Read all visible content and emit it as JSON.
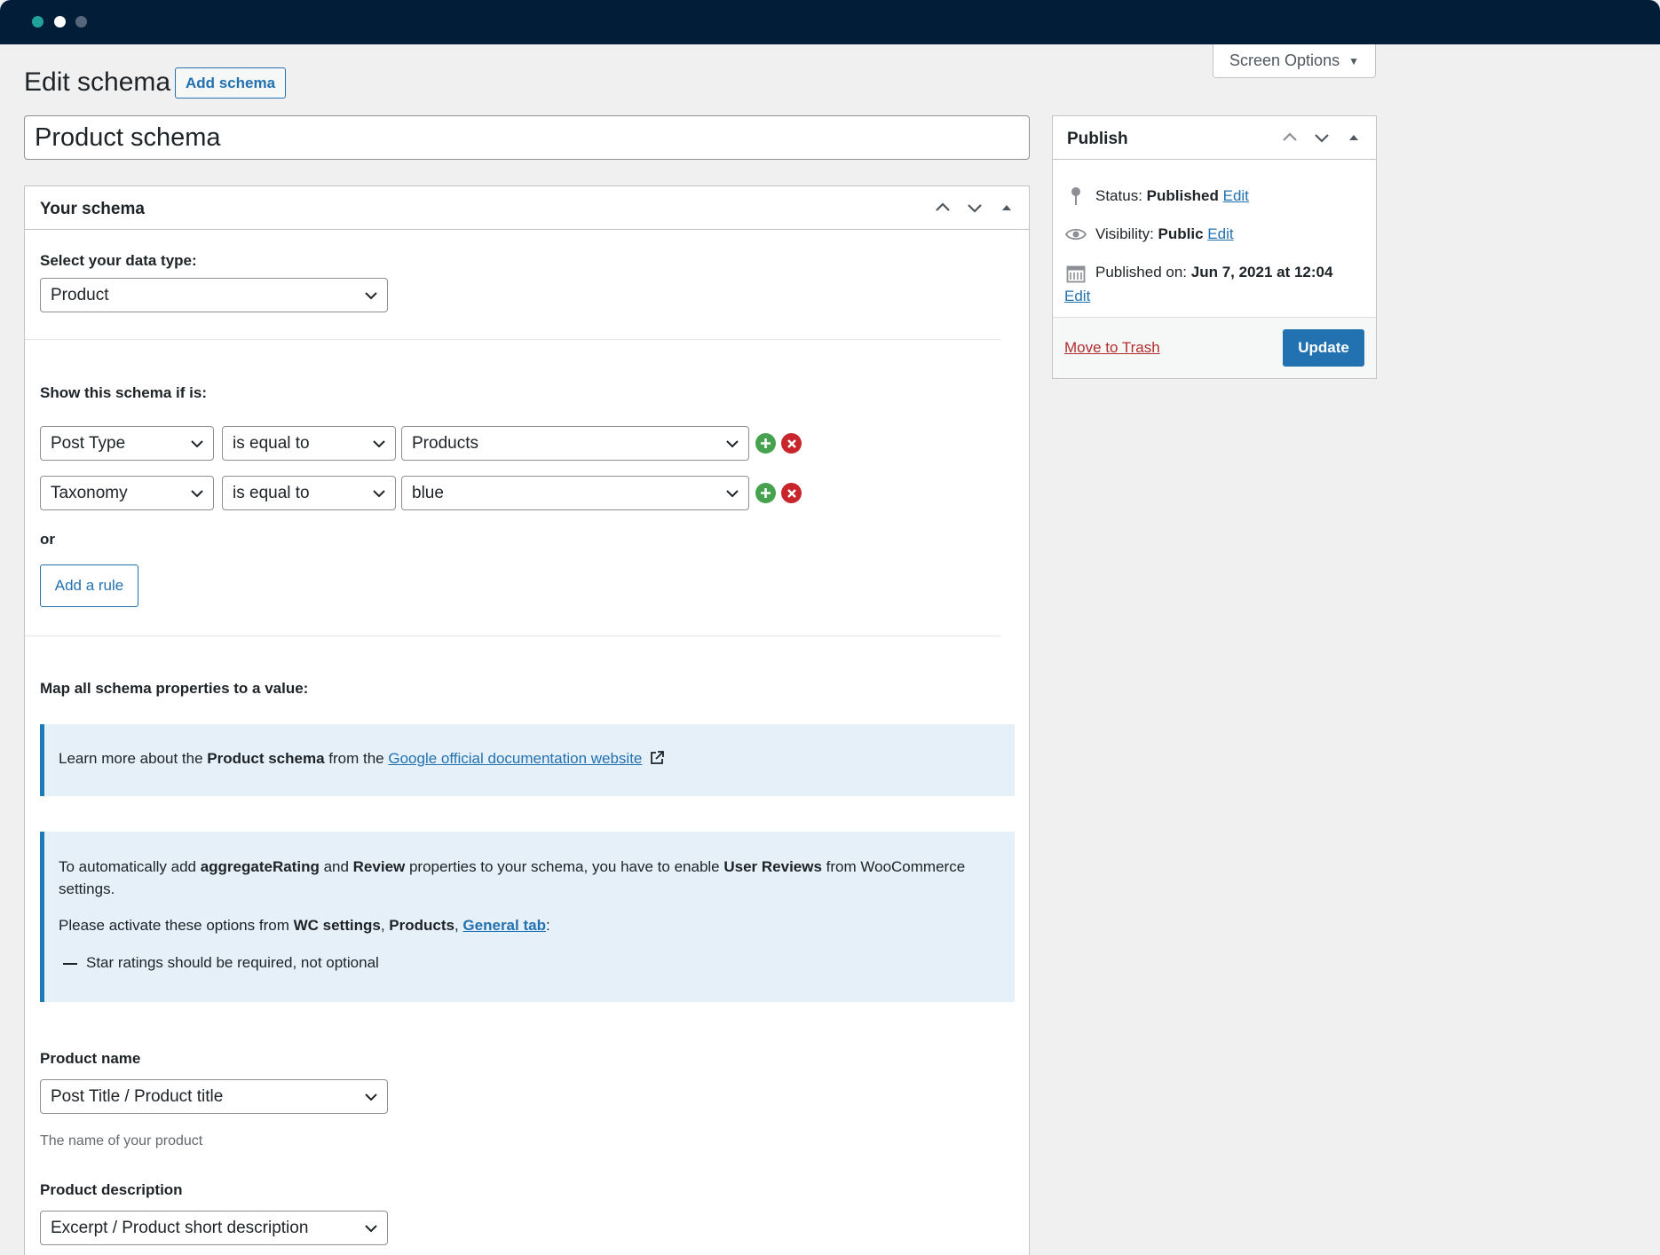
{
  "window": {
    "screen_options_label": "Screen Options"
  },
  "header": {
    "title": "Edit schema",
    "add_button": "Add schema"
  },
  "post_title": "Product schema",
  "schema_box": {
    "title": "Your schema",
    "data_type_label": "Select your data type:",
    "data_type_value": "Product",
    "show_if_label": "Show this schema if is:",
    "rules": [
      {
        "param": "Post Type",
        "operator": "is equal to",
        "value": "Products"
      },
      {
        "param": "Taxonomy",
        "operator": "is equal to",
        "value": "blue"
      }
    ],
    "or_label": "or",
    "add_rule_button": "Add a rule",
    "map_label": "Map all schema properties to a value:",
    "notice1": {
      "prefix": "Learn more about the ",
      "bold": "Product schema",
      "middle": " from the ",
      "link": "Google official documentation website"
    },
    "notice2": {
      "p1_a": "To automatically add ",
      "p1_b": "aggregateRating",
      "p1_c": " and ",
      "p1_d": "Review",
      "p1_e": " properties to your schema, you have to enable ",
      "p1_f": "User Reviews",
      "p1_g": " from WooCommerce settings.",
      "p2_a": "Please activate these options from ",
      "p2_b": "WC settings",
      "p2_c": ", ",
      "p2_d": "Products",
      "p2_e": ", ",
      "p2_link": "General tab",
      "p2_f": ":",
      "bullet": "Star ratings should be required, not optional"
    },
    "fields": [
      {
        "label": "Product name",
        "value": "Post Title / Product title",
        "help": "The name of your product"
      },
      {
        "label": "Product description",
        "value": "Excerpt / Product short description"
      }
    ]
  },
  "publish": {
    "title": "Publish",
    "status_label": "Status: ",
    "status_value": "Published",
    "visibility_label": "Visibility: ",
    "visibility_value": "Public",
    "published_label": "Published on: ",
    "published_value": "Jun 7, 2021 at 12:04",
    "edit_link": "Edit",
    "trash_link": "Move to Trash",
    "update_button": "Update"
  },
  "colors": {
    "accent": "#2271b1",
    "topbar": "#021d38",
    "add_icon": "#46a24f",
    "delete_icon": "#c8252c",
    "trash": "#b32d2e"
  }
}
